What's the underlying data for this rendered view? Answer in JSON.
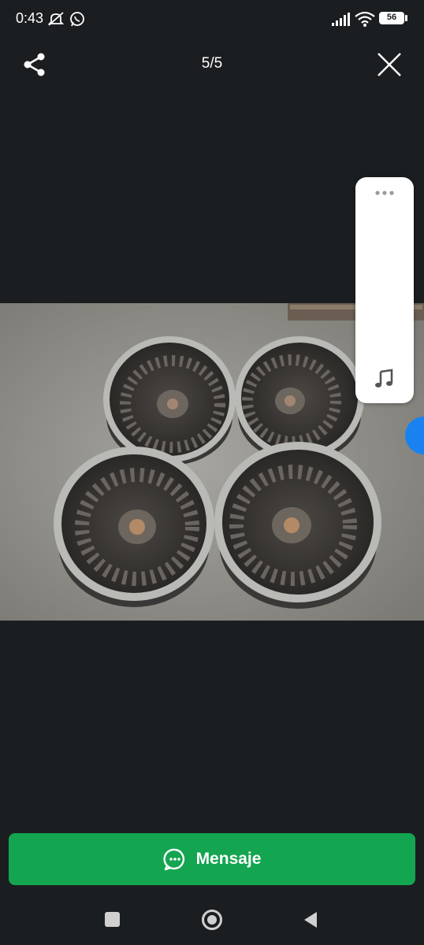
{
  "status_bar": {
    "time": "0:43",
    "battery": "56",
    "icons": [
      "do-not-disturb-off-icon",
      "whatsapp-icon",
      "signal-icon",
      "wifi-icon",
      "battery-icon"
    ]
  },
  "top_bar": {
    "counter": "5/5",
    "share_icon": "share-icon",
    "close_icon": "close-icon"
  },
  "side_panel": {
    "more_icon": "more-horizontal-icon",
    "music_icon": "music-note-icon"
  },
  "message_button": {
    "label": "Mensaje",
    "icon": "chat-bubble-icon",
    "color": "#14a550"
  },
  "nav_bar": {
    "icons": [
      "recents-square-icon",
      "home-circle-icon",
      "back-triangle-icon"
    ]
  }
}
